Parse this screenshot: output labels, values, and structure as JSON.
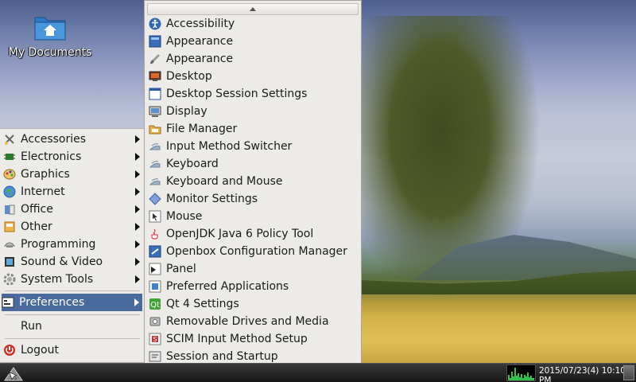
{
  "desktop": {
    "icon_label": "My Documents"
  },
  "main_menu": {
    "items": [
      {
        "label": "Accessories",
        "icon": "accessories-icon"
      },
      {
        "label": "Electronics",
        "icon": "electronics-icon"
      },
      {
        "label": "Graphics",
        "icon": "graphics-icon"
      },
      {
        "label": "Internet",
        "icon": "internet-globe-icon"
      },
      {
        "label": "Office",
        "icon": "office-icon"
      },
      {
        "label": "Other",
        "icon": "other-icon"
      },
      {
        "label": "Programming",
        "icon": "programming-icon"
      },
      {
        "label": "Sound & Video",
        "icon": "sound-video-icon"
      },
      {
        "label": "System Tools",
        "icon": "system-tools-gear-icon"
      }
    ],
    "preferences_label": "Preferences",
    "run_label": "Run",
    "logout_label": "Logout"
  },
  "preferences_menu": {
    "items": [
      {
        "label": "Accessibility",
        "icon": "accessibility-icon"
      },
      {
        "label": "Appearance",
        "icon": "appearance-icon"
      },
      {
        "label": "Appearance",
        "icon": "appearance-brush-icon"
      },
      {
        "label": "Desktop",
        "icon": "desktop-icon"
      },
      {
        "label": "Desktop Session Settings",
        "icon": "session-settings-icon"
      },
      {
        "label": "Display",
        "icon": "display-icon"
      },
      {
        "label": "File Manager",
        "icon": "file-manager-icon"
      },
      {
        "label": "Input Method Switcher",
        "icon": "input-method-icon"
      },
      {
        "label": "Keyboard",
        "icon": "keyboard-icon"
      },
      {
        "label": "Keyboard and Mouse",
        "icon": "keyboard-mouse-icon"
      },
      {
        "label": "Monitor Settings",
        "icon": "monitor-settings-icon"
      },
      {
        "label": "Mouse",
        "icon": "mouse-icon"
      },
      {
        "label": "OpenJDK Java 6 Policy Tool",
        "icon": "java-icon"
      },
      {
        "label": "Openbox Configuration Manager",
        "icon": "openbox-icon"
      },
      {
        "label": "Panel",
        "icon": "panel-icon"
      },
      {
        "label": "Preferred Applications",
        "icon": "preferred-apps-icon"
      },
      {
        "label": "Qt 4 Settings",
        "icon": "qt-icon"
      },
      {
        "label": "Removable Drives and Media",
        "icon": "removable-drive-icon"
      },
      {
        "label": "SCIM Input Method Setup",
        "icon": "scim-icon"
      },
      {
        "label": "Session and Startup",
        "icon": "session-startup-icon"
      }
    ]
  },
  "taskbar": {
    "clock": "2015/07/23(4) 10:10 PM"
  },
  "colors": {
    "menu_bg": "#edebe8",
    "highlight": "#4a6a9e",
    "taskbar": "#1e1e1e",
    "logout_red": "#d42a1e"
  }
}
